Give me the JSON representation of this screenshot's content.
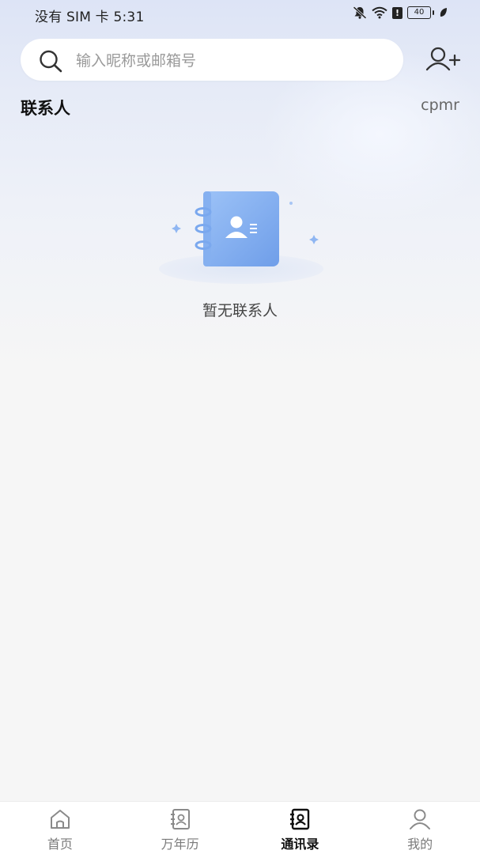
{
  "status_bar": {
    "left_text": "没有 SIM 卡 5:31",
    "battery_level": "40",
    "alert_badge": "!",
    "icons": [
      "bell-muted-icon",
      "wifi-icon",
      "alert-icon",
      "battery-icon",
      "leaf-icon"
    ]
  },
  "search": {
    "placeholder": "输入昵称或邮箱号",
    "value": ""
  },
  "header": {
    "title": "联系人",
    "right_text": "cpmr"
  },
  "empty_state": {
    "message": "暂无联系人",
    "icon": "contact-book-icon"
  },
  "bottom_nav": {
    "items": [
      {
        "label": "首页",
        "icon": "home-icon"
      },
      {
        "label": "万年历",
        "icon": "calendar-book-icon"
      },
      {
        "label": "通讯录",
        "icon": "contacts-icon",
        "active": true
      },
      {
        "label": "我的",
        "icon": "profile-icon"
      }
    ]
  },
  "colors": {
    "accent_blue": "#7aa8ee",
    "background": "#f6f6f6",
    "active_text": "#111111",
    "inactive_text": "#7a7a7a"
  }
}
